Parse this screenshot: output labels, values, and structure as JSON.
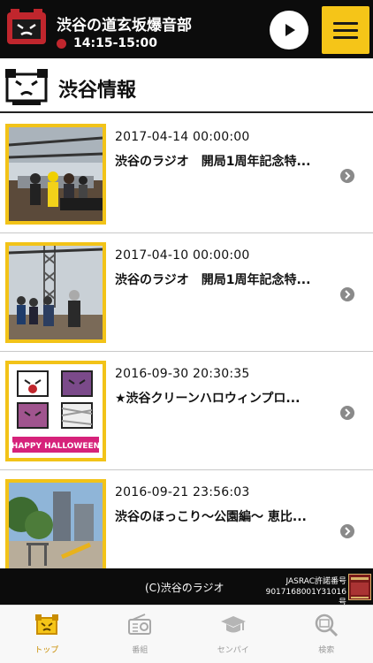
{
  "now_playing": {
    "program_title": "渋谷の道玄坂爆音部",
    "time_slot": "14:15-15:00"
  },
  "section": {
    "title": "渋谷情報"
  },
  "articles": [
    {
      "date": "2017-04-14 00:00:00",
      "title": "渋谷のラジオ　開局1周年記念特..."
    },
    {
      "date": "2017-04-10 00:00:00",
      "title": "渋谷のラジオ　開局1周年記念特..."
    },
    {
      "date": "2016-09-30 20:30:35",
      "title": "★渋谷クリーンハロウィンプロ..."
    },
    {
      "date": "2016-09-21 23:56:03",
      "title": "渋谷のほっこり〜公園編〜 恵比..."
    }
  ],
  "thumb_texts": {
    "halloween": "HAPPY HALLOWEEN"
  },
  "footer": {
    "copyright": "(C)渋谷のラジオ",
    "jasrac_label": "JASRAC許諾番号",
    "jasrac_number": "9017168001Y31016号"
  },
  "tabs": [
    {
      "label": "トップ",
      "icon": "top-icon",
      "active": true
    },
    {
      "label": "番組",
      "icon": "radio-icon",
      "active": false
    },
    {
      "label": "センパイ",
      "icon": "graduation-cap-icon",
      "active": false
    },
    {
      "label": "検索",
      "icon": "search-icon",
      "active": false
    }
  ],
  "colors": {
    "accent": "#f5c518",
    "thumb_border": "#f2c318",
    "header_bg": "#0c0c0c",
    "live_dot": "#c0262d",
    "tab_active": "#c98d00"
  }
}
